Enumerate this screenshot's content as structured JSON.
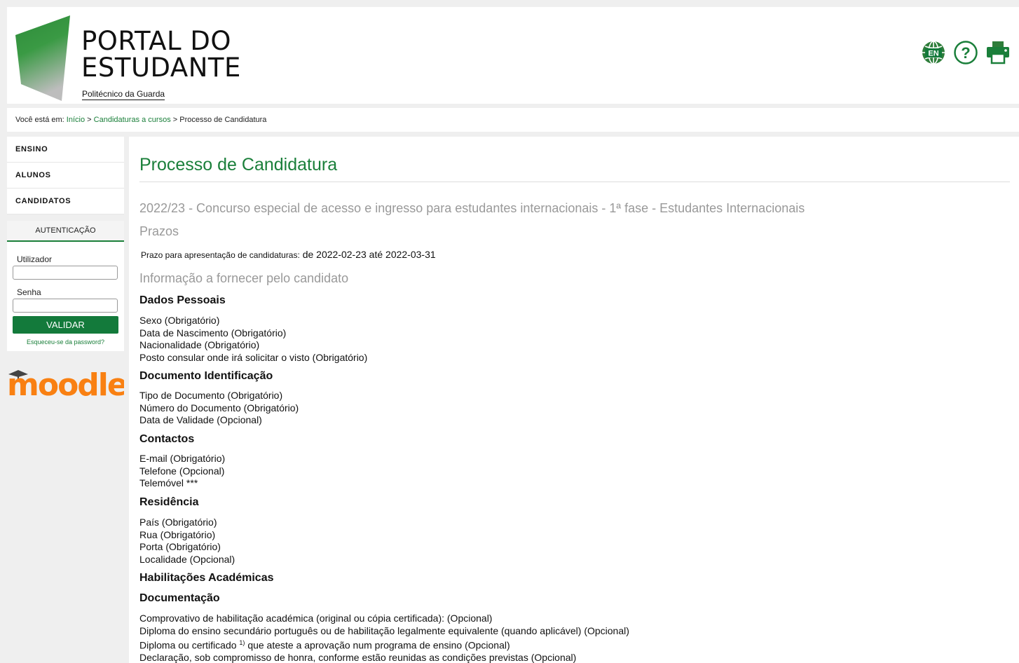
{
  "header": {
    "title_line1": "PORTAL DO",
    "title_line2": "ESTUDANTE",
    "subtitle": "Politécnico da Guarda",
    "lang_label": "EN",
    "help_label": "?"
  },
  "breadcrumb": {
    "prefix": "Você está em:",
    "home": "Início",
    "sep": ">",
    "link2": "Candidaturas a cursos",
    "current": "Processo de Candidatura"
  },
  "sidebar": {
    "menu": [
      "ENSINO",
      "ALUNOS",
      "CANDIDATOS"
    ],
    "auth": {
      "title": "AUTENTICAÇÃO",
      "user_label": "Utilizador",
      "user_value": "",
      "pass_label": "Senha",
      "pass_value": "",
      "submit": "VALIDAR",
      "forgot": "Esqueceu-se da password?"
    },
    "moodle_text": "moodle"
  },
  "main": {
    "title": "Processo de Candidatura",
    "contest": "2022/23 - Concurso especial de acesso e ingresso para estudantes internacionais - 1ª fase - Estudantes Internacionais",
    "prazos_h": "Prazos",
    "deadline_label": "Prazo para apresentação de candidaturas:",
    "deadline_value": "de 2022-02-23 até 2022-03-31",
    "info_h": "Informação a fornecer pelo candidato",
    "dados_h": "Dados Pessoais",
    "dados": [
      "Sexo (Obrigatório)",
      "Data de Nascimento (Obrigatório)",
      "Nacionalidade (Obrigatório)",
      "Posto consular onde irá solicitar o visto (Obrigatório)"
    ],
    "doc_h": "Documento Identificação",
    "doc": [
      "Tipo de Documento (Obrigatório)",
      "Número do Documento (Obrigatório)",
      "Data de Validade (Opcional)"
    ],
    "contactos_h": "Contactos",
    "contactos": [
      "E-mail (Obrigatório)",
      "Telefone (Opcional)",
      "Telemóvel ***"
    ],
    "residencia_h": "Residência",
    "residencia": [
      "País (Obrigatório)",
      "Rua (Obrigatório)",
      "Porta (Obrigatório)",
      "Localidade (Opcional)"
    ],
    "habilitacoes_h": "Habilitações Académicas",
    "documentacao_h": "Documentação",
    "documentacao_1": "Comprovativo de habilitação académica (original ou cópia certificada): (Opcional)",
    "documentacao_2": "Diploma do ensino secundário português ou de habilitação legalmente equivalente (quando aplicável) (Opcional)",
    "documentacao_3a": "Diploma ou certificado",
    "documentacao_3sup": "1)",
    "documentacao_3b": "que ateste a aprovação num programa de ensino (Opcional)",
    "documentacao_4": "Declaração, sob compromisso de honra, conforme estão reunidas as condições previstas (Opcional)"
  },
  "colors": {
    "accent": "#1a7f3a",
    "button": "#137a3b",
    "muted": "#999999",
    "moodle": "#f98012"
  },
  "icons": [
    "globe-icon",
    "help-icon",
    "printer-icon"
  ]
}
